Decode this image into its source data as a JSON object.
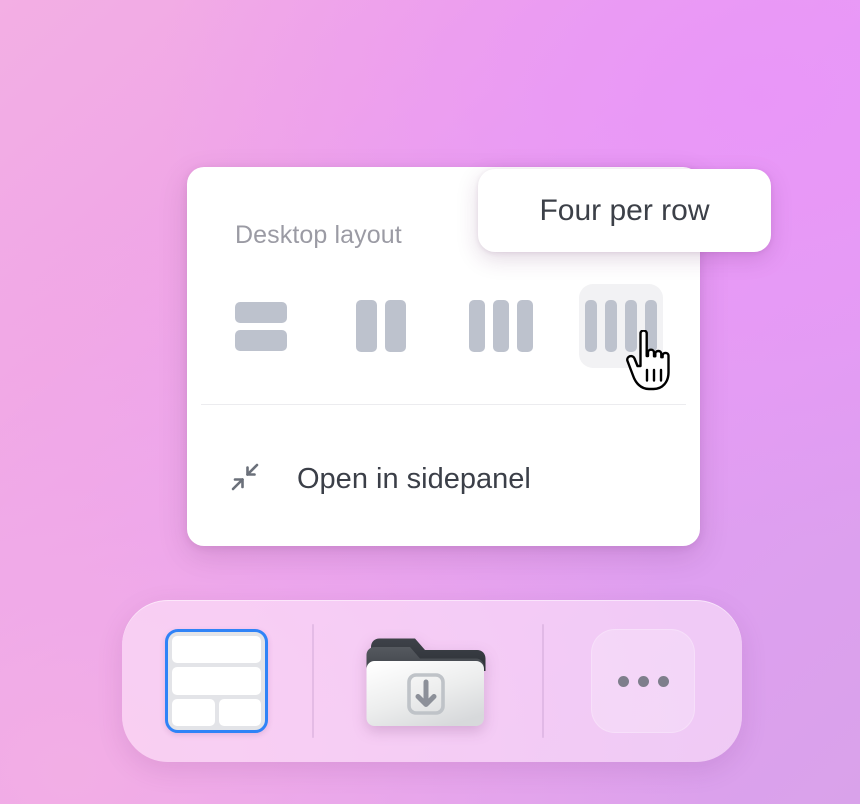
{
  "panel": {
    "section_label": "Desktop layout",
    "layout_options": [
      {
        "name": "one-per-row",
        "icon": "rows-stacked-icon",
        "selected": false,
        "hovered": false
      },
      {
        "name": "two-per-row",
        "icon": "two-columns-icon",
        "selected": false,
        "hovered": false
      },
      {
        "name": "three-per-row",
        "icon": "three-columns-icon",
        "selected": false,
        "hovered": false
      },
      {
        "name": "four-per-row",
        "icon": "four-columns-icon",
        "selected": false,
        "hovered": true
      }
    ],
    "sidepanel_item": {
      "label": "Open in sidepanel",
      "icon": "collapse-arrows-icon"
    }
  },
  "tooltip": {
    "text": "Four per row"
  },
  "cursor": {
    "type": "pointing-hand-cursor"
  },
  "dock": {
    "items": [
      {
        "name": "layout-thumbnail",
        "type": "layout-preview",
        "selected": true
      },
      {
        "name": "downloads-folder",
        "type": "folder-download-icon"
      },
      {
        "name": "more-options",
        "type": "ellipsis-icon"
      }
    ]
  },
  "colors": {
    "accent_selected": "#2f83f7",
    "icon_gray": "#bdc2cd",
    "label_gray": "#9b9ba4",
    "text_dark": "#3b3f48",
    "panel_bg": "#ffffff",
    "hover_bg": "#f2f2f4",
    "background_gradient_start": "#f3afe4",
    "background_gradient_end": "#d9a2ea"
  }
}
